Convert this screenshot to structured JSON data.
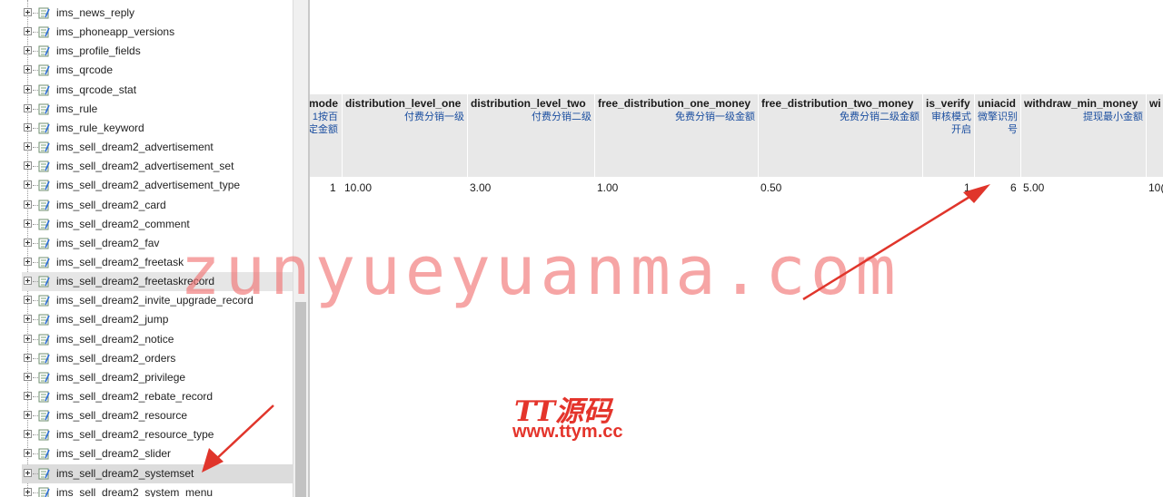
{
  "tree": {
    "items": [
      {
        "label": "ims_news_reply"
      },
      {
        "label": "ims_phoneapp_versions"
      },
      {
        "label": "ims_profile_fields"
      },
      {
        "label": "ims_qrcode"
      },
      {
        "label": "ims_qrcode_stat"
      },
      {
        "label": "ims_rule"
      },
      {
        "label": "ims_rule_keyword"
      },
      {
        "label": "ims_sell_dream2_advertisement"
      },
      {
        "label": "ims_sell_dream2_advertisement_set"
      },
      {
        "label": "ims_sell_dream2_advertisement_type"
      },
      {
        "label": "ims_sell_dream2_card"
      },
      {
        "label": "ims_sell_dream2_comment"
      },
      {
        "label": "ims_sell_dream2_fav"
      },
      {
        "label": "ims_sell_dream2_freetask"
      },
      {
        "label": "ims_sell_dream2_freetaskrecord"
      },
      {
        "label": "ims_sell_dream2_invite_upgrade_record"
      },
      {
        "label": "ims_sell_dream2_jump"
      },
      {
        "label": "ims_sell_dream2_notice"
      },
      {
        "label": "ims_sell_dream2_orders"
      },
      {
        "label": "ims_sell_dream2_privilege"
      },
      {
        "label": "ims_sell_dream2_rebate_record"
      },
      {
        "label": "ims_sell_dream2_resource"
      },
      {
        "label": "ims_sell_dream2_resource_type"
      },
      {
        "label": "ims_sell_dream2_slider"
      },
      {
        "label": "ims_sell_dream2_systemset"
      },
      {
        "label": "ims_sell_dream2_system_menu"
      }
    ],
    "selected": "ims_sell_dream2_systemset",
    "hovered": "ims_sell_dream2_freetaskrecord"
  },
  "grid": {
    "columns": [
      {
        "name": "mode",
        "comment": "1按百\n定金额",
        "value": "1"
      },
      {
        "name": "distribution_level_one",
        "comment": "付费分销一级",
        "value": "10.00"
      },
      {
        "name": "distribution_level_two",
        "comment": "付费分销二级",
        "value": "3.00"
      },
      {
        "name": "free_distribution_one_money",
        "comment": "免费分销一级金额",
        "value": "1.00"
      },
      {
        "name": "free_distribution_two_money",
        "comment": "免费分销二级金额",
        "value": "0.50"
      },
      {
        "name": "is_verify",
        "comment": "审核模式\n开启",
        "value": "1"
      },
      {
        "name": "uniacid",
        "comment": "微擎识别\n号",
        "value": "6"
      },
      {
        "name": "withdraw_min_money",
        "comment": "提现最小金额",
        "value": "5.00"
      },
      {
        "name": "wi",
        "comment": "",
        "value": "10("
      }
    ]
  },
  "watermark": {
    "text": "zunyueyuanma.com",
    "logo_title": "TT源码",
    "logo_url": "www.ttym.cc"
  },
  "colors": {
    "header_bg": "#e8e8e8",
    "comment_text": "#1c4fa0",
    "arrow": "#e0352b",
    "watermark": "#f06e6e"
  }
}
